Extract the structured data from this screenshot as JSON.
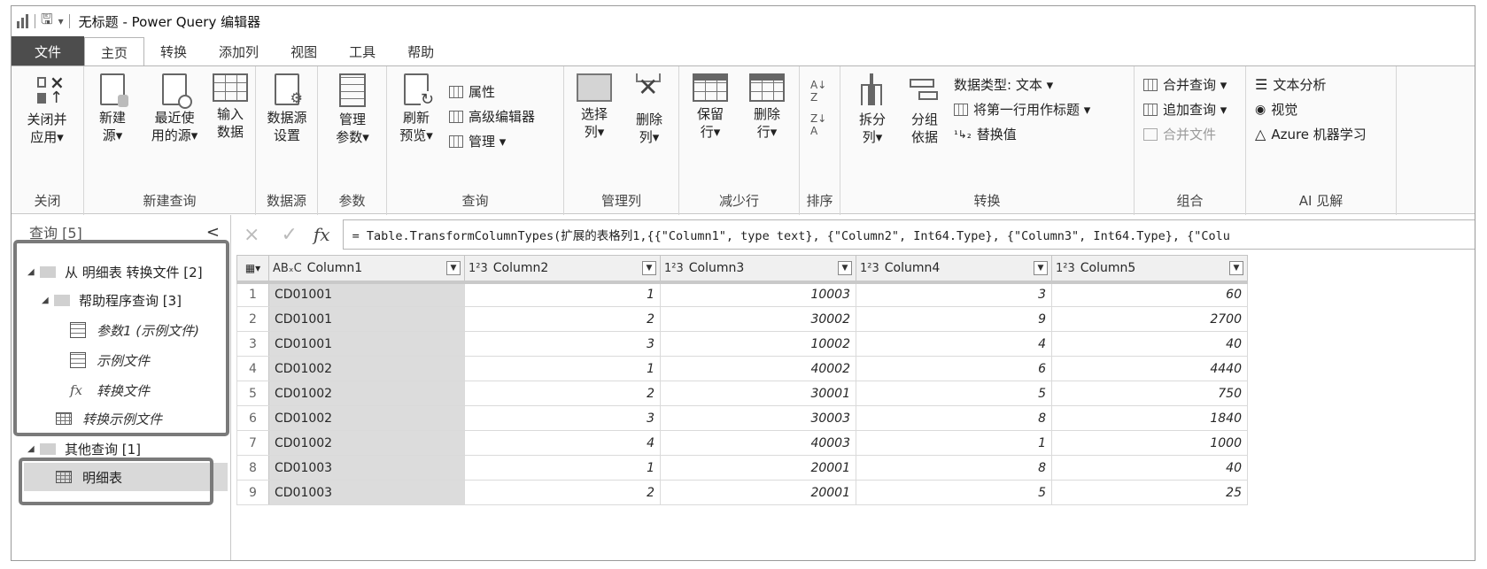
{
  "window": {
    "title": "无标题 - Power Query 编辑器"
  },
  "tabs": [
    "文件",
    "主页",
    "转换",
    "添加列",
    "视图",
    "工具",
    "帮助"
  ],
  "ribbon": {
    "close": {
      "button": "关闭并\n应用▾",
      "label": "关闭"
    },
    "new_query": {
      "buttons": [
        "新建\n源▾",
        "最近使\n用的源▾",
        "输入\n数据"
      ],
      "label": "新建查询"
    },
    "datasource": {
      "button": "数据源\n设置",
      "label": "数据源"
    },
    "params": {
      "button": "管理\n参数▾",
      "label": "参数"
    },
    "query": {
      "refresh": "刷新\n预览▾",
      "properties": "属性",
      "advanced_editor": "高级编辑器",
      "manage": "管理 ▾",
      "label": "查询"
    },
    "manage_cols": {
      "buttons": [
        "选择\n列▾",
        "删除\n列▾"
      ],
      "label": "管理列"
    },
    "reduce_rows": {
      "buttons": [
        "保留\n行▾",
        "删除\n行▾"
      ],
      "label": "减少行"
    },
    "sort": {
      "label": "排序"
    },
    "transform": {
      "split": "拆分\n列▾",
      "group": "分组\n依据",
      "datatype": "数据类型: 文本 ▾",
      "first_row_header": "将第一行用作标题 ▾",
      "replace": "替换值",
      "label": "转换"
    },
    "combine": {
      "merge": "合并查询 ▾",
      "append": "追加查询 ▾",
      "combine_files": "合并文件",
      "label": "组合"
    },
    "ai": {
      "text_analytics": "文本分析",
      "vision": "视觉",
      "azure_ml": "Azure 机器学习",
      "label": "AI 见解"
    }
  },
  "queries_pane": {
    "header": "查询 [5]",
    "collapse": "<",
    "items": [
      {
        "label": "从 明细表 转换文件 [2]"
      },
      {
        "label": "帮助程序查询 [3]"
      },
      {
        "label": "参数1 (示例文件)"
      },
      {
        "label": "示例文件"
      },
      {
        "label": "转换文件"
      },
      {
        "label": "转换示例文件"
      },
      {
        "label": "其他查询 [1]"
      },
      {
        "label": "明细表"
      }
    ]
  },
  "formula_bar": {
    "cancel": "×",
    "confirm": "✓",
    "fx": "fx",
    "formula": "= Table.TransformColumnTypes(扩展的表格列1,{{\"Column1\", type text}, {\"Column2\", Int64.Type}, {\"Column3\", Int64.Type}, {\"Colu"
  },
  "table": {
    "columns": [
      {
        "type": "ABₓC",
        "name": "Column1"
      },
      {
        "type": "1²3",
        "name": "Column2"
      },
      {
        "type": "1²3",
        "name": "Column3"
      },
      {
        "type": "1²3",
        "name": "Column4"
      },
      {
        "type": "1²3",
        "name": "Column5"
      }
    ],
    "rows": [
      [
        "1",
        "CD01001",
        "1",
        "10003",
        "3",
        "60"
      ],
      [
        "2",
        "CD01001",
        "2",
        "30002",
        "9",
        "2700"
      ],
      [
        "3",
        "CD01001",
        "3",
        "10002",
        "4",
        "40"
      ],
      [
        "4",
        "CD01002",
        "1",
        "40002",
        "6",
        "4440"
      ],
      [
        "5",
        "CD01002",
        "2",
        "30001",
        "5",
        "750"
      ],
      [
        "6",
        "CD01002",
        "3",
        "30003",
        "8",
        "1840"
      ],
      [
        "7",
        "CD01002",
        "4",
        "40003",
        "1",
        "1000"
      ],
      [
        "8",
        "CD01003",
        "1",
        "20001",
        "8",
        "40"
      ],
      [
        "9",
        "CD01003",
        "2",
        "20001",
        "5",
        "25"
      ]
    ]
  }
}
